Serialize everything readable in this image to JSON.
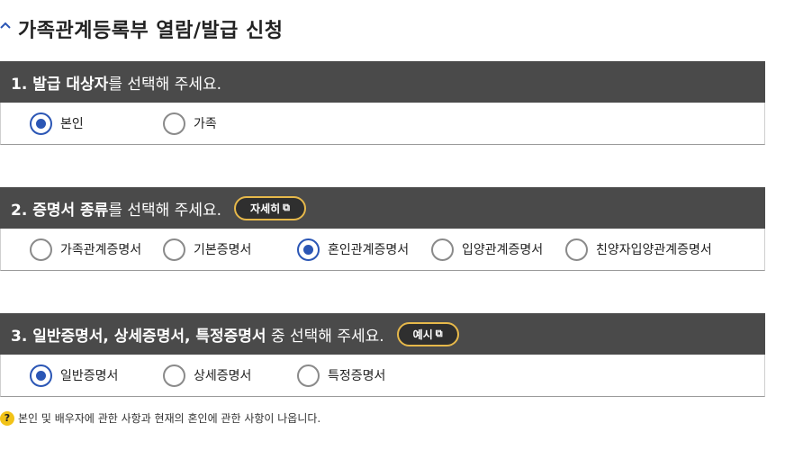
{
  "header": {
    "title": "가족관계등록부 열람/발급 신청"
  },
  "sections": [
    {
      "bold": "1. 발급 대상자",
      "rest": "를 선택해 주세요.",
      "options": [
        "본인",
        "가족"
      ],
      "selected": 0
    },
    {
      "bold": "2. 증명서 종류",
      "rest": "를 선택해 주세요.",
      "button": "자세히",
      "options": [
        "가족관계증명서",
        "기본증명서",
        "혼인관계증명서",
        "입양관계증명서",
        "친양자입양관계증명서"
      ],
      "selected": 2
    },
    {
      "bold": "3. 일반증명서, 상세증명서, 특정증명서",
      "rest": " 중 선택해 주세요.",
      "button": "예시",
      "options": [
        "일반증명서",
        "상세증명서",
        "특정증명서"
      ],
      "selected": 0
    }
  ],
  "note": {
    "icon": "?",
    "text": "본인 및 배우자에 관한 사항과 현재의 혼인에 관한 사항이 나옵니다."
  },
  "colors": {
    "header_bg": "#4a4a4a",
    "radio_selected": "#2b56b5",
    "button_border": "#e6b84a",
    "help_icon": "#f2c318"
  }
}
